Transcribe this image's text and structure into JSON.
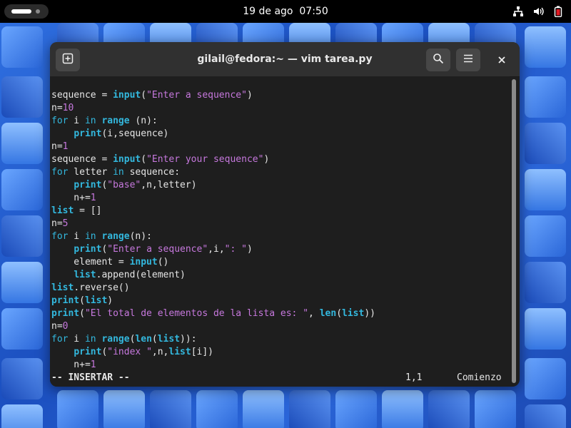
{
  "topbar": {
    "date": "19 de ago",
    "time": "07:50",
    "tray_icons": [
      "network-icon",
      "volume-icon",
      "battery-icon"
    ]
  },
  "window": {
    "title": "gilail@fedora:~ — vim tarea.py",
    "buttons": [
      "new-tab-icon",
      "search-icon",
      "menu-icon",
      "close-icon"
    ]
  },
  "editor": {
    "lines": [
      [
        {
          "t": "sequence = "
        },
        {
          "t": "input",
          "c": "fn"
        },
        {
          "t": "("
        },
        {
          "t": "\"Enter a sequence\"",
          "c": "str"
        },
        {
          "t": ")"
        }
      ],
      [
        {
          "t": "n="
        },
        {
          "t": "10",
          "c": "num"
        }
      ],
      [
        {
          "t": "for",
          "c": "kw"
        },
        {
          "t": " i "
        },
        {
          "t": "in",
          "c": "kw"
        },
        {
          "t": " "
        },
        {
          "t": "range",
          "c": "fn"
        },
        {
          "t": " (n):"
        }
      ],
      [
        {
          "t": "    "
        },
        {
          "t": "print",
          "c": "fn"
        },
        {
          "t": "(i,sequence)"
        }
      ],
      [
        {
          "t": "n="
        },
        {
          "t": "1",
          "c": "num"
        }
      ],
      [
        {
          "t": "sequence = "
        },
        {
          "t": "input",
          "c": "fn"
        },
        {
          "t": "("
        },
        {
          "t": "\"Enter your sequence\"",
          "c": "str"
        },
        {
          "t": ")"
        }
      ],
      [
        {
          "t": "for",
          "c": "kw"
        },
        {
          "t": " letter "
        },
        {
          "t": "in",
          "c": "kw"
        },
        {
          "t": " sequence:"
        }
      ],
      [
        {
          "t": "    "
        },
        {
          "t": "print",
          "c": "fn"
        },
        {
          "t": "("
        },
        {
          "t": "\"base\"",
          "c": "str"
        },
        {
          "t": ",n,letter)"
        }
      ],
      [
        {
          "t": "    n+="
        },
        {
          "t": "1",
          "c": "num"
        }
      ],
      [
        {
          "t": "list",
          "c": "fn"
        },
        {
          "t": " = []"
        }
      ],
      [
        {
          "t": "n="
        },
        {
          "t": "5",
          "c": "num"
        }
      ],
      [
        {
          "t": "for",
          "c": "kw"
        },
        {
          "t": " i "
        },
        {
          "t": "in",
          "c": "kw"
        },
        {
          "t": " "
        },
        {
          "t": "range",
          "c": "fn"
        },
        {
          "t": "(n):"
        }
      ],
      [
        {
          "t": "    "
        },
        {
          "t": "print",
          "c": "fn"
        },
        {
          "t": "("
        },
        {
          "t": "\"Enter a sequence\"",
          "c": "str"
        },
        {
          "t": ",i,"
        },
        {
          "t": "\": \"",
          "c": "str"
        },
        {
          "t": ")"
        }
      ],
      [
        {
          "t": "    element = "
        },
        {
          "t": "input",
          "c": "fn"
        },
        {
          "t": "()"
        }
      ],
      [
        {
          "t": "    "
        },
        {
          "t": "list",
          "c": "fn"
        },
        {
          "t": ".append(element)"
        }
      ],
      [
        {
          "t": "list",
          "c": "fn"
        },
        {
          "t": ".reverse()"
        }
      ],
      [
        {
          "t": "print",
          "c": "fn"
        },
        {
          "t": "("
        },
        {
          "t": "list",
          "c": "fn"
        },
        {
          "t": ")"
        }
      ],
      [
        {
          "t": "print",
          "c": "fn"
        },
        {
          "t": "("
        },
        {
          "t": "\"El total de elementos de la lista es: \"",
          "c": "str"
        },
        {
          "t": ", "
        },
        {
          "t": "len",
          "c": "fn"
        },
        {
          "t": "("
        },
        {
          "t": "list",
          "c": "fn"
        },
        {
          "t": "))"
        }
      ],
      [
        {
          "t": "n="
        },
        {
          "t": "0",
          "c": "num"
        }
      ],
      [
        {
          "t": "for",
          "c": "kw"
        },
        {
          "t": " i "
        },
        {
          "t": "in",
          "c": "kw"
        },
        {
          "t": " "
        },
        {
          "t": "range",
          "c": "fn"
        },
        {
          "t": "("
        },
        {
          "t": "len",
          "c": "fn"
        },
        {
          "t": "("
        },
        {
          "t": "list",
          "c": "fn"
        },
        {
          "t": ")):"
        }
      ],
      [
        {
          "t": "    "
        },
        {
          "t": "print",
          "c": "fn"
        },
        {
          "t": "("
        },
        {
          "t": "\"index \"",
          "c": "str"
        },
        {
          "t": ",n,"
        },
        {
          "t": "list",
          "c": "fn"
        },
        {
          "t": "[i])"
        }
      ],
      [
        {
          "t": "    n+="
        },
        {
          "t": "1",
          "c": "num"
        }
      ]
    ],
    "status": {
      "mode": "-- INSERTAR --",
      "cursor": "1,1",
      "scroll": "Comienzo"
    }
  },
  "colors": {
    "keyword": "#33b8de",
    "string": "#c678dd",
    "background": "#1e1e1e"
  }
}
